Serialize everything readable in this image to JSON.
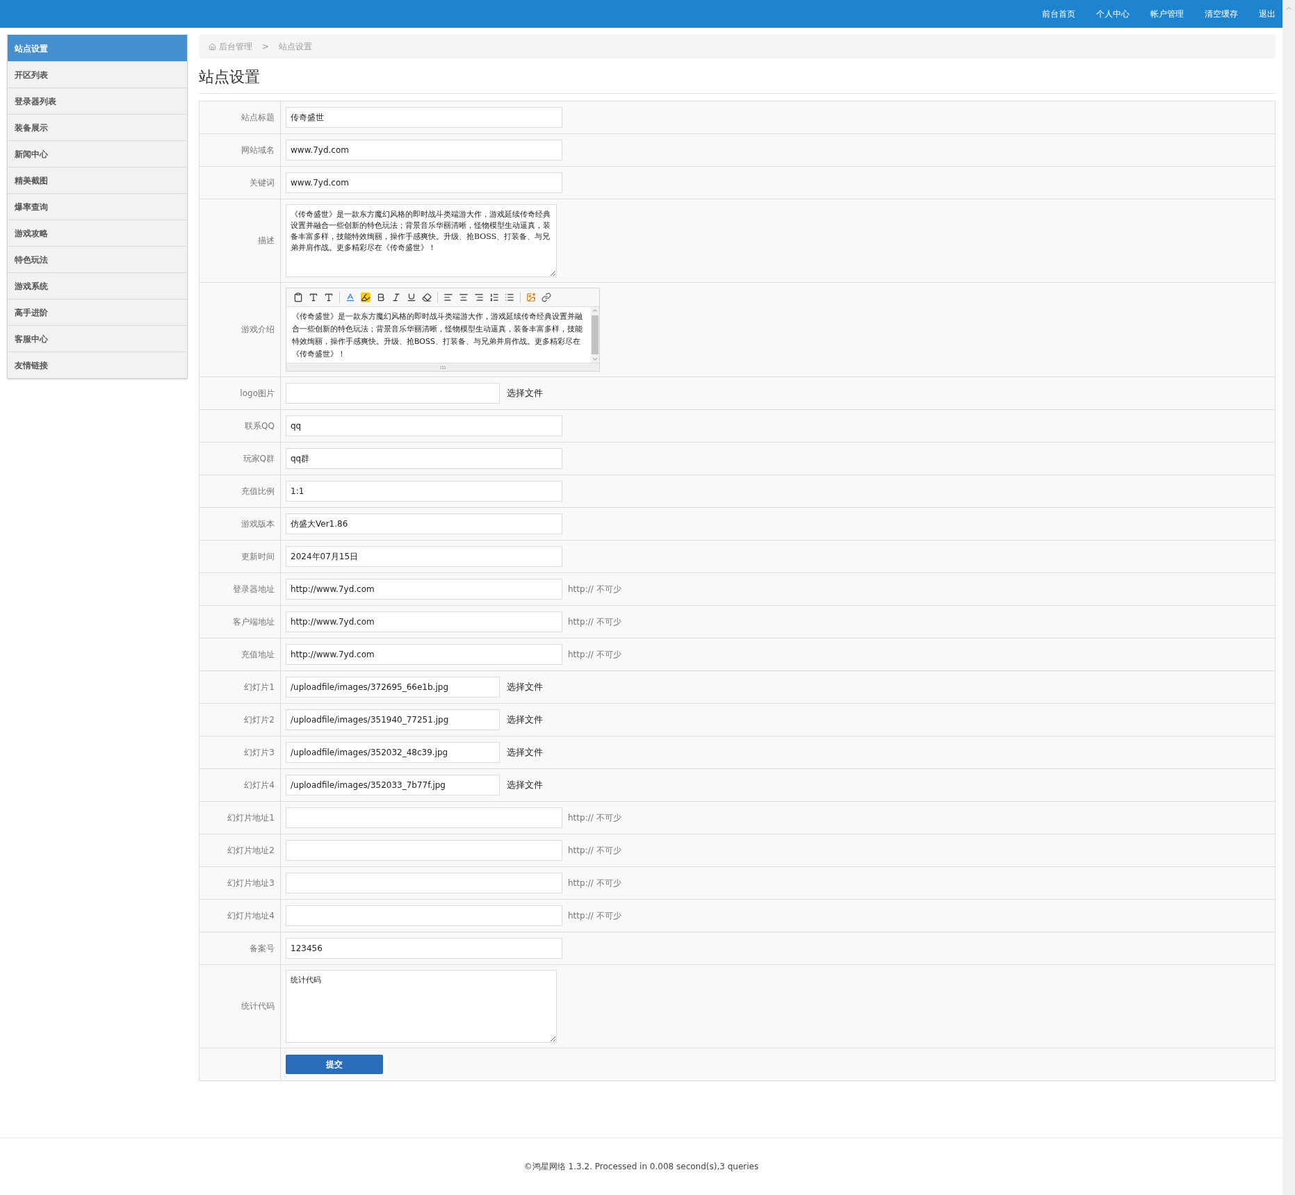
{
  "topnav": [
    "前台首页",
    "个人中心",
    "帐户管理",
    "清空缓存",
    "退出"
  ],
  "sidebar": {
    "items": [
      {
        "label": "站点设置",
        "selected": true
      },
      {
        "label": "开区列表",
        "selected": false
      },
      {
        "label": "登录器列表",
        "selected": false
      },
      {
        "label": "装备展示",
        "selected": false
      },
      {
        "label": "新闻中心",
        "selected": false
      },
      {
        "label": "精美截图",
        "selected": false
      },
      {
        "label": "爆率查询",
        "selected": false
      },
      {
        "label": "游戏攻略",
        "selected": false
      },
      {
        "label": "特色玩法",
        "selected": false
      },
      {
        "label": "游戏系统",
        "selected": false
      },
      {
        "label": "高手进阶",
        "selected": false
      },
      {
        "label": "客服中心",
        "selected": false
      },
      {
        "label": "友情链接",
        "selected": false
      }
    ]
  },
  "breadcrumb": [
    "后台管理",
    ">",
    "站点设置"
  ],
  "page_title": "站点设置",
  "form": {
    "rows": [
      {
        "kind": "text",
        "label": "站点标题",
        "value": "传奇盛世"
      },
      {
        "kind": "text",
        "label": "网站域名",
        "value": "www.7yd.com"
      },
      {
        "kind": "text",
        "label": "关键词",
        "value": "www.7yd.com"
      },
      {
        "kind": "textarea",
        "label": "描述",
        "value": "《传奇盛世》是一款东方魔幻风格的即时战斗类端游大作，游戏延续传奇经典设置并融合一些创新的特色玩法；背景音乐华丽清晰，怪物模型生动逼真，装备丰富多样，技能特效绚丽，操作手感爽快。升级、抢BOSS、打装备、与兄弟并肩作战。更多精彩尽在《传奇盛世》！"
      },
      {
        "kind": "editor",
        "label": "游戏介绍",
        "value": "《传奇盛世》是一款东方魔幻风格的即时战斗类端游大作，游戏延续传奇经典设置并融合一些创新的特色玩法；背景音乐华丽清晰，怪物模型生动逼真，装备丰富多样，技能特效绚丽，操作手感爽快。升级、抢BOSS、打装备、与兄弟并肩作战。更多精彩尽在《传奇盛世》！"
      },
      {
        "kind": "file",
        "label": "logo图片",
        "button": "选择文件"
      },
      {
        "kind": "text",
        "label": "联系QQ",
        "value": "qq"
      },
      {
        "kind": "text",
        "label": "玩家Q群",
        "value": "qq群"
      },
      {
        "kind": "text",
        "label": "充值比例",
        "value": "1:1"
      },
      {
        "kind": "text",
        "label": "游戏版本",
        "value": "仿盛大Ver1.86"
      },
      {
        "kind": "text",
        "label": "更新时间",
        "value": "2024年07月15日"
      },
      {
        "kind": "text",
        "label": "登录器地址",
        "value": "http://www.7yd.com",
        "hint": "http:// 不可少"
      },
      {
        "kind": "text",
        "label": "客户端地址",
        "value": "http://www.7yd.com",
        "hint": "http:// 不可少"
      },
      {
        "kind": "text",
        "label": "充值地址",
        "value": "http://www.7yd.com",
        "hint": "http:// 不可少"
      },
      {
        "kind": "file",
        "label": "幻灯片1",
        "value": "/uploadfile/images/372695_66e1b.jpg",
        "button": "选择文件"
      },
      {
        "kind": "file",
        "label": "幻灯片2",
        "value": "/uploadfile/images/351940_77251.jpg",
        "button": "选择文件"
      },
      {
        "kind": "file",
        "label": "幻灯片3",
        "value": "/uploadfile/images/352032_48c39.jpg",
        "button": "选择文件"
      },
      {
        "kind": "file",
        "label": "幻灯片4",
        "value": "/uploadfile/images/352033_7b77f.jpg",
        "button": "选择文件"
      },
      {
        "kind": "text",
        "label": "幻灯片地址1",
        "hint": "http:// 不可少"
      },
      {
        "kind": "text",
        "label": "幻灯片地址2",
        "hint": "http:// 不可少"
      },
      {
        "kind": "text",
        "label": "幻灯片地址3",
        "hint": "http:// 不可少"
      },
      {
        "kind": "text",
        "label": "幻灯片地址4",
        "hint": "http:// 不可少"
      },
      {
        "kind": "text",
        "label": "备案号",
        "value": "123456"
      },
      {
        "kind": "textarea",
        "label": "统计代码",
        "value": "统计代码"
      },
      {
        "kind": "submit",
        "button": "提交"
      }
    ]
  },
  "footer": "©鸿星网络 1.3.2. Processed in 0.008 second(s),3 queries"
}
